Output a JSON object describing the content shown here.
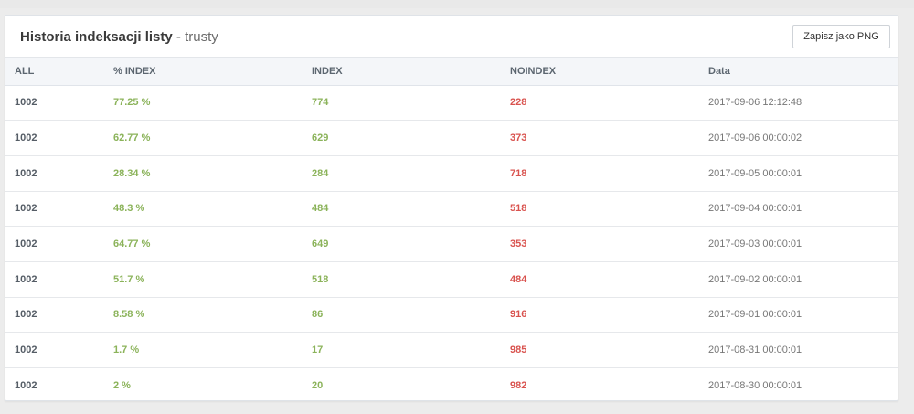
{
  "panel": {
    "title": "Historia indeksacji listy",
    "subtitle": " - trusty",
    "save_button": "Zapisz jako PNG"
  },
  "table": {
    "headers": [
      "ALL",
      "% INDEX",
      "INDEX",
      "NOINDEX",
      "Data"
    ],
    "rows": [
      {
        "all": "1002",
        "pct": "77.25 %",
        "index": "774",
        "noindex": "228",
        "date": "2017-09-06 12:12:48"
      },
      {
        "all": "1002",
        "pct": "62.77 %",
        "index": "629",
        "noindex": "373",
        "date": "2017-09-06 00:00:02"
      },
      {
        "all": "1002",
        "pct": "28.34 %",
        "index": "284",
        "noindex": "718",
        "date": "2017-09-05 00:00:01"
      },
      {
        "all": "1002",
        "pct": "48.3 %",
        "index": "484",
        "noindex": "518",
        "date": "2017-09-04 00:00:01"
      },
      {
        "all": "1002",
        "pct": "64.77 %",
        "index": "649",
        "noindex": "353",
        "date": "2017-09-03 00:00:01"
      },
      {
        "all": "1002",
        "pct": "51.7 %",
        "index": "518",
        "noindex": "484",
        "date": "2017-09-02 00:00:01"
      },
      {
        "all": "1002",
        "pct": "8.58 %",
        "index": "86",
        "noindex": "916",
        "date": "2017-09-01 00:00:01"
      },
      {
        "all": "1002",
        "pct": "1.7 %",
        "index": "17",
        "noindex": "985",
        "date": "2017-08-31 00:00:01"
      },
      {
        "all": "1002",
        "pct": "2 %",
        "index": "20",
        "noindex": "982",
        "date": "2017-08-30 00:00:01"
      }
    ]
  },
  "colors": {
    "positive": "#8bb35a",
    "negative": "#d9534f",
    "header_bg": "#f4f6f9"
  }
}
